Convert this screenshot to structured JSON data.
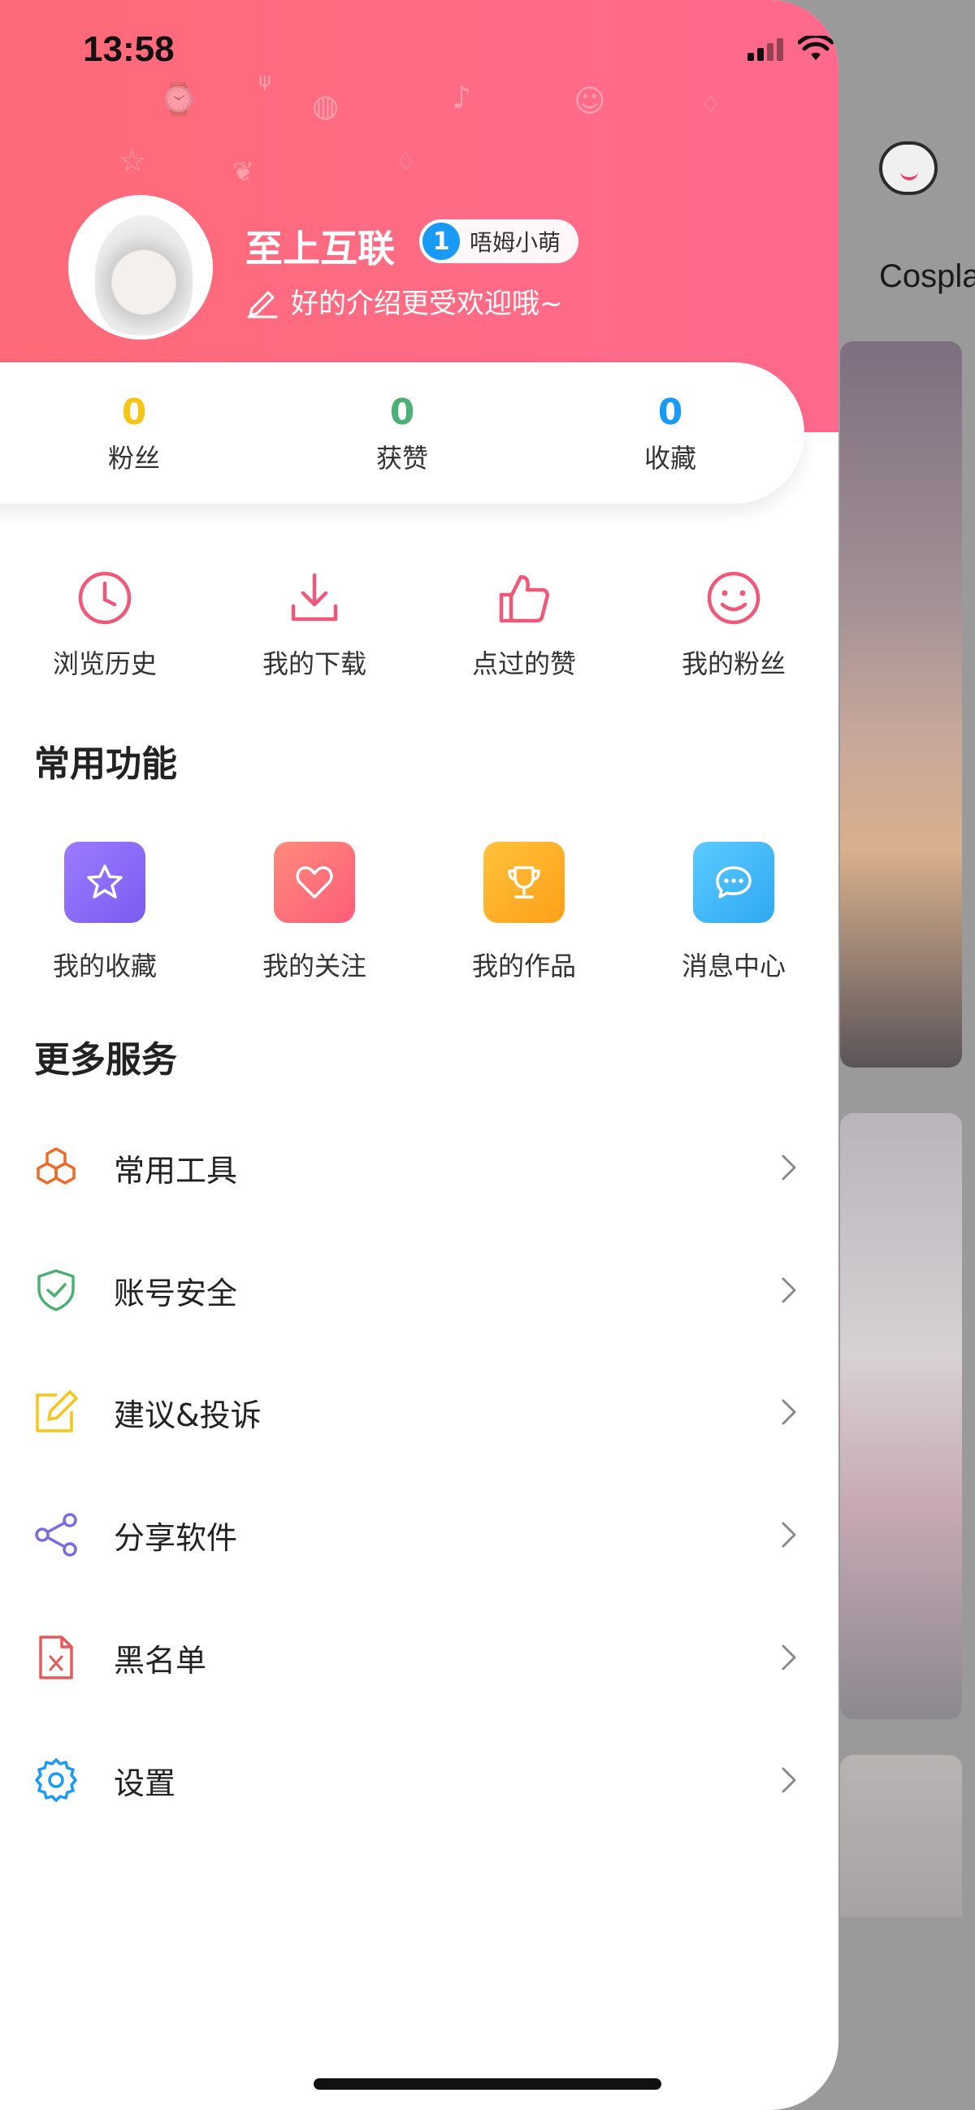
{
  "status": {
    "time": "13:58"
  },
  "background": {
    "tab_label": "Cospla"
  },
  "profile": {
    "username": "至上互联",
    "level_num": "1",
    "level_name": "唔姆小萌",
    "bio": "好的介绍更受欢迎哦~"
  },
  "stats": [
    {
      "value": "0",
      "label": "粉丝",
      "color": "#f5c518"
    },
    {
      "value": "0",
      "label": "获赞",
      "color": "#4caf73"
    },
    {
      "value": "0",
      "label": "收藏",
      "color": "#1a9af7"
    }
  ],
  "quick": [
    {
      "label": "浏览历史",
      "icon": "clock-icon"
    },
    {
      "label": "我的下载",
      "icon": "download-icon"
    },
    {
      "label": "点过的赞",
      "icon": "thumbs-up-icon"
    },
    {
      "label": "我的粉丝",
      "icon": "smile-icon"
    }
  ],
  "sections": {
    "common": "常用功能",
    "more": "更多服务"
  },
  "functions": [
    {
      "label": "我的收藏",
      "icon": "star-icon",
      "color": "#8b6cf6"
    },
    {
      "label": "我的关注",
      "icon": "heart-icon",
      "color": "#ff6b7a"
    },
    {
      "label": "我的作品",
      "icon": "trophy-icon",
      "color": "#ffb02e"
    },
    {
      "label": "消息中心",
      "icon": "message-icon",
      "color": "#3ab8f5"
    }
  ],
  "menu": [
    {
      "label": "常用工具",
      "icon": "tools-icon",
      "color": "#f06a24"
    },
    {
      "label": "账号安全",
      "icon": "shield-icon",
      "color": "#4caf73"
    },
    {
      "label": "建议&投诉",
      "icon": "edit-icon",
      "color": "#f5c518"
    },
    {
      "label": "分享软件",
      "icon": "share-icon",
      "color": "#7b6be0"
    },
    {
      "label": "黑名单",
      "icon": "blacklist-file-icon",
      "color": "#e85a5a"
    },
    {
      "label": "设置",
      "icon": "gear-icon",
      "color": "#1a9af7"
    }
  ],
  "colors": {
    "header": "#ff6b86",
    "accent_pink": "#f0587a"
  }
}
